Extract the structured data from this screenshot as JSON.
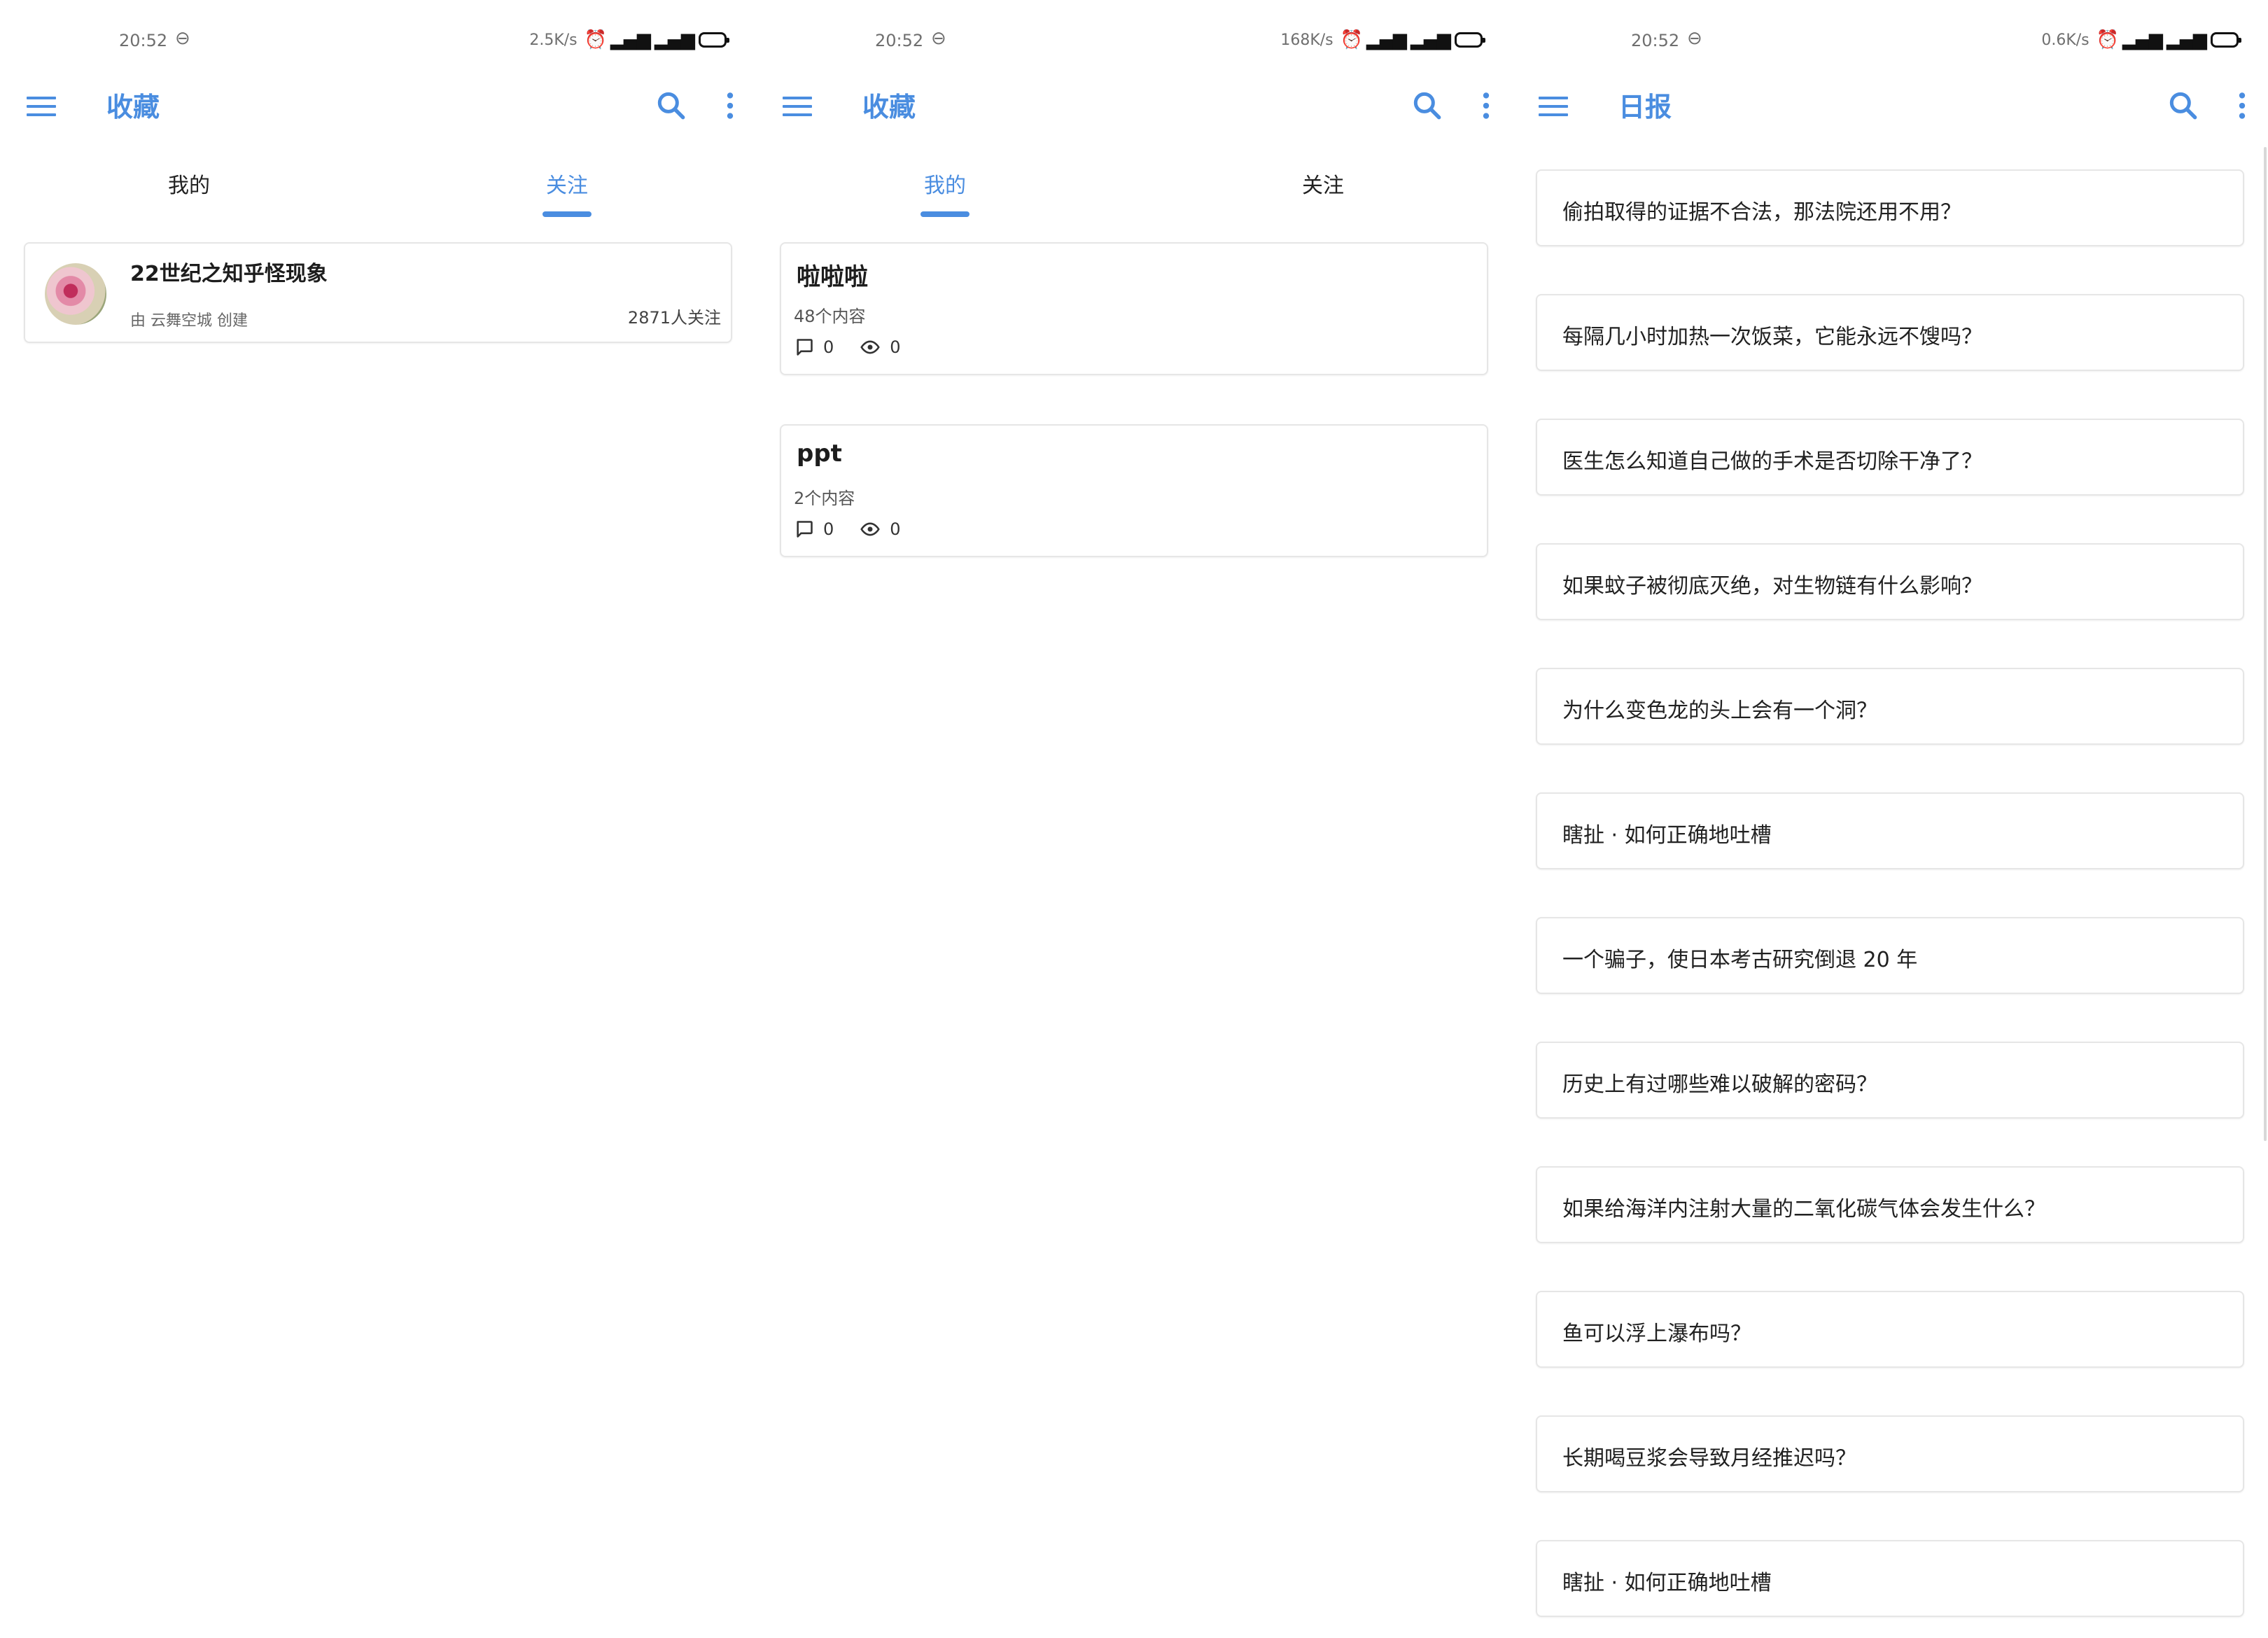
{
  "screens": [
    {
      "status": {
        "time": "20:52",
        "speed": "2.5K/s"
      },
      "appbar": {
        "title": "收藏"
      },
      "tabs": [
        {
          "label": "我的"
        },
        {
          "label": "关注"
        }
      ],
      "active_tab": "关注",
      "follow_card": {
        "title": "22世纪之知乎怪现象",
        "creator": "由 云舞空城 创建",
        "followers": "2871人关注"
      }
    },
    {
      "status": {
        "time": "20:52",
        "speed": "168K/s"
      },
      "appbar": {
        "title": "收藏"
      },
      "tabs": [
        {
          "label": "我的"
        },
        {
          "label": "关注"
        }
      ],
      "active_tab": "我的",
      "collections": [
        {
          "title": "啦啦啦",
          "subtitle": "48个内容",
          "comments": "0",
          "views": "0"
        },
        {
          "title": "ppt",
          "subtitle": "2个内容",
          "comments": "0",
          "views": "0"
        }
      ]
    },
    {
      "status": {
        "time": "20:52",
        "speed": "0.6K/s"
      },
      "appbar": {
        "title": "日报"
      },
      "daily_items": [
        "偷拍取得的证据不合法，那法院还用不用？",
        "每隔几小时加热一次饭菜，它能永远不馊吗？",
        "医生怎么知道自己做的手术是否切除干净了？",
        "如果蚊子被彻底灭绝，对生物链有什么影响？",
        "为什么变色龙的头上会有一个洞？",
        "瞎扯 · 如何正确地吐槽",
        "一个骗子，使日本考古研究倒退 20 年",
        "历史上有过哪些难以破解的密码？",
        "如果给海洋内注射大量的二氧化碳气体会发生什么？",
        "鱼可以浮上瀑布吗？",
        "长期喝豆浆会导致月经推迟吗？",
        "瞎扯 · 如何正确地吐槽"
      ]
    }
  ],
  "status_icons": [
    "link-icon",
    "alarm-icon",
    "signal-icon",
    "signal-icon-2",
    "battery-icon"
  ],
  "colors": {
    "accent": "#4a8de0",
    "text": "#212121",
    "card_border": "#e6e6e6"
  }
}
